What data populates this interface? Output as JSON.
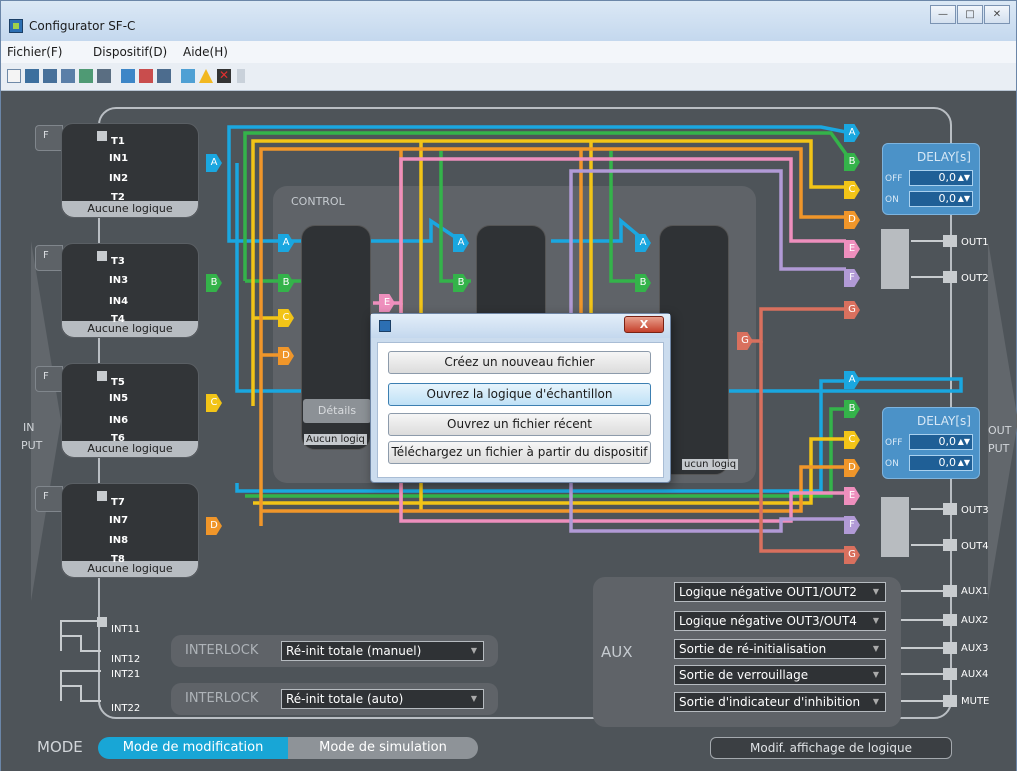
{
  "window": {
    "title": "Configurator SF-C",
    "controls": [
      "—",
      "□",
      "✕"
    ]
  },
  "menu": [
    "Fichier(F)",
    "Dispositif(D)",
    "Aide(H)"
  ],
  "toolbar_icons": [
    "new-file-icon",
    "open-folder-icon",
    "save-icon",
    "save-as-icon",
    "copy-icon",
    "print-icon",
    "upload-icon",
    "download-icon",
    "monitor-icon",
    "verify-icon",
    "warning-icon",
    "delete-icon",
    "more-icon"
  ],
  "inputs": [
    {
      "tab": "F",
      "pins": [
        "T1",
        "IN1",
        "IN2",
        "T2"
      ],
      "caption": "Aucune logique",
      "tag": "A"
    },
    {
      "tab": "F",
      "pins": [
        "T3",
        "IN3",
        "IN4",
        "T4"
      ],
      "caption": "Aucune logique",
      "tag": "B"
    },
    {
      "tab": "F",
      "pins": [
        "T5",
        "IN5",
        "IN6",
        "T6"
      ],
      "caption": "Aucune logique",
      "tag": "C"
    },
    {
      "tab": "F",
      "pins": [
        "T7",
        "IN7",
        "IN8",
        "T8"
      ],
      "caption": "Aucune logique",
      "tag": "D"
    }
  ],
  "side": {
    "in_top": "IN",
    "in_bottom": "PUT",
    "out_top": "OUT",
    "out_bottom": "PUT"
  },
  "control": {
    "label": "CONTROL",
    "block1_caption": "Aucun logiq",
    "block3_caption": "ucun logiq",
    "details": "Détails"
  },
  "delay": [
    {
      "title": "DELAY[s]",
      "off_label": "OFF",
      "off_value": "0,0",
      "on_label": "ON",
      "on_value": "0,0"
    },
    {
      "title": "DELAY[s]",
      "off_label": "OFF",
      "off_value": "0,0",
      "on_label": "ON",
      "on_value": "0,0"
    }
  ],
  "outputs": [
    "OUT1",
    "OUT2",
    "OUT3",
    "OUT4"
  ],
  "interlock": {
    "int_labels": [
      "INT11",
      "INT12",
      "INT21",
      "INT22"
    ],
    "rows": [
      {
        "label": "INTERLOCK",
        "value": "Ré-init totale (manuel)"
      },
      {
        "label": "INTERLOCK",
        "value": "Ré-init totale (auto)"
      }
    ]
  },
  "aux": {
    "label": "AUX",
    "selects": [
      "Logique négative OUT1/OUT2",
      "Logique négative OUT3/OUT4",
      "Sortie de ré-initialisation",
      "Sortie de verrouillage",
      "Sortie d'indicateur d'inhibition"
    ],
    "outputs": [
      "AUX1",
      "AUX2",
      "AUX3",
      "AUX4",
      "MUTE"
    ]
  },
  "mode": {
    "label": "MODE",
    "edit": "Mode de modification",
    "sim": "Mode de simulation",
    "logic_display": "Modif. affichage de logique"
  },
  "dialog": {
    "close": "X",
    "buttons": [
      "Créez un nouveau fichier",
      "Ouvrez la logique d'échantillon",
      "Ouvrez un fichier récent",
      "Téléchargez un fichier à partir du dispositif"
    ]
  },
  "colors": {
    "A": "#1aa7e0",
    "B": "#34b34a",
    "C": "#f2c417",
    "D": "#f0962a",
    "E": "#ee8fbd",
    "F": "#b19ad6",
    "G": "#d9705e"
  }
}
